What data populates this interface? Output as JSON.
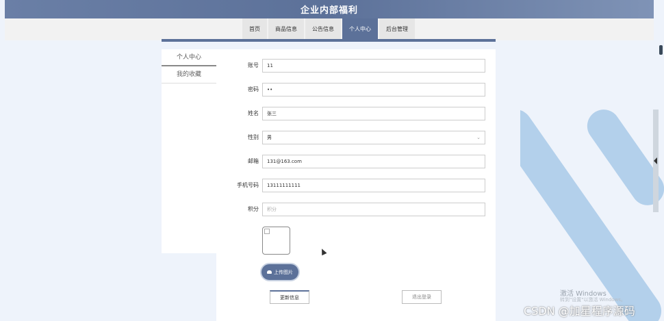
{
  "header": {
    "title": "企业内部福利"
  },
  "nav": {
    "items": [
      {
        "label": "首页",
        "active": false
      },
      {
        "label": "商品信息",
        "active": false
      },
      {
        "label": "公告信息",
        "active": false
      },
      {
        "label": "个人中心",
        "active": true
      },
      {
        "label": "后台管理",
        "active": false
      }
    ]
  },
  "sidebar": {
    "items": [
      {
        "label": "个人中心",
        "active": true
      },
      {
        "label": "我的收藏",
        "active": false
      }
    ]
  },
  "form": {
    "account": {
      "label": "账号",
      "value": "11"
    },
    "password": {
      "label": "密码",
      "value": "••"
    },
    "name": {
      "label": "姓名",
      "value": "张三"
    },
    "gender": {
      "label": "性别",
      "value": "男"
    },
    "email": {
      "label": "邮箱",
      "value": "131@163.com"
    },
    "phone": {
      "label": "手机号码",
      "value": "13111111111"
    },
    "points": {
      "label": "积分",
      "placeholder": "积分"
    }
  },
  "actions": {
    "upload_label": "上传图片",
    "update_label": "更新信息",
    "logout_label": "退出登录"
  },
  "watermark": {
    "line1": "激活 Windows",
    "line2": "转到\"设置\"以激活 Windows。"
  },
  "csdn_mark": "CSDN @加星程序源码",
  "colors": {
    "primary": "#5c7199",
    "background": "#eef3fb"
  }
}
